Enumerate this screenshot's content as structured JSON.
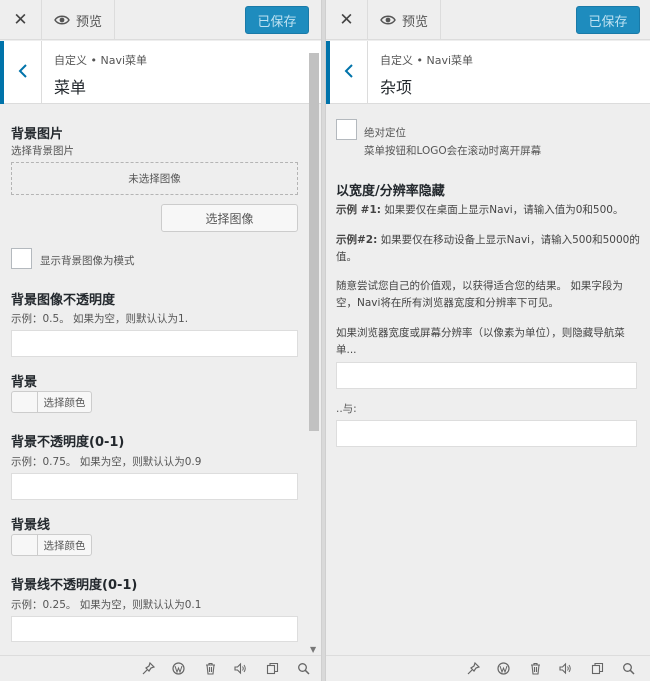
{
  "left": {
    "topbar": {
      "preview_label": "预览",
      "save_label": "已保存"
    },
    "header": {
      "breadcrumb": "自定义 • Navi菜单",
      "title": "菜单"
    },
    "bg_image": {
      "title": "背景图片",
      "subtitle": "选择背景图片",
      "placeholder": "未选择图像",
      "select_button": "选择图像",
      "pattern_label": "显示背景图像为模式"
    },
    "bg_image_opacity": {
      "title": "背景图像不透明度",
      "hint": "示例：0.5。 如果为空，则默认认为1.",
      "value": ""
    },
    "background": {
      "title": "背景",
      "color_button": "选择颜色"
    },
    "bg_opacity": {
      "title": "背景不透明度(0-1)",
      "hint": "示例：0.75。 如果为空，则默认认为0.9",
      "value": ""
    },
    "bg_line": {
      "title": "背景线",
      "color_button": "选择颜色"
    },
    "bg_line_opacity": {
      "title": "背景线不透明度(0-1)",
      "hint": "示例：0.25。 如果为空，则默认认为0.1",
      "value": ""
    }
  },
  "right": {
    "topbar": {
      "preview_label": "预览",
      "save_label": "已保存"
    },
    "header": {
      "breadcrumb": "自定义 • Navi菜单",
      "title": "杂项"
    },
    "absolute": {
      "label": "绝对定位",
      "desc": "菜单按钮和LOGO会在滚动时离开屏幕"
    },
    "hide_section": {
      "title": "以宽度/分辨率隐藏",
      "example1_bold": "示例 #1:",
      "example1_text": " 如果要仅在桌面上显示Navi，请输入值为0和500。",
      "example2_bold": "示例#2:",
      "example2_text": " 如果要仅在移动设备上显示Navi，请输入500和5000的值。",
      "note": "随意尝试您自己的价值观，以获得适合您的结果。 如果字段为空，Navi将在所有浏览器宽度和分辨率下可见。",
      "field_label": "如果浏览器宽度或屏幕分辨率（以像素为单位），则隐藏导航菜单...",
      "and_label": "..与:",
      "value_from": "",
      "value_to": ""
    }
  },
  "footer_icons": [
    "pin-icon",
    "wordpress-icon",
    "trash-icon",
    "sound-icon",
    "duplicate-icon",
    "search-icon"
  ],
  "colors": {
    "accent": "#0073aa",
    "save_button": "#1e8cbe",
    "panel_bg": "#eeeeee"
  }
}
